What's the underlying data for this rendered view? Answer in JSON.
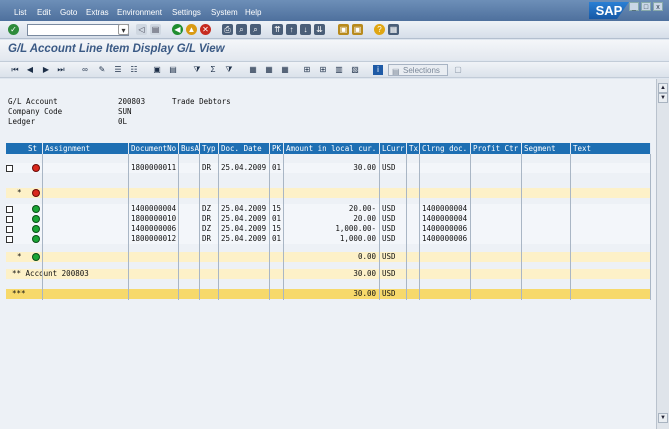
{
  "menu": {
    "items": [
      "List",
      "Edit",
      "Goto",
      "Extras",
      "Environment",
      "Settings",
      "System",
      "Help"
    ]
  },
  "logo": "SAP",
  "window_controls": [
    "_",
    "□",
    "x"
  ],
  "command_field": {
    "value": ""
  },
  "title": "G/L Account Line Item Display G/L View",
  "app_toolbar": {
    "selections_label": "Selections"
  },
  "header_fields": [
    {
      "label": "G/L Account",
      "value": "200803",
      "desc": "Trade Debtors"
    },
    {
      "label": "Company Code",
      "value": "SUN",
      "desc": ""
    },
    {
      "label": "Ledger",
      "value": "0L",
      "desc": ""
    }
  ],
  "table": {
    "columns": [
      "St",
      "Assignment",
      "DocumentNo",
      "BusA",
      "Typ",
      "Doc. Date",
      "PK",
      "Amount in local cur.",
      "LCurr",
      "Tx",
      "Clrng doc.",
      "Profit Ctr",
      "Segment",
      "Text"
    ],
    "rows": [
      {
        "kind": "item",
        "status": "red",
        "checkbox": true,
        "mark": "",
        "assignment": "",
        "docno": "1800000011",
        "busa": "",
        "typ": "DR",
        "date": "25.04.2009",
        "pk": "01",
        "amount": "30.00",
        "curr": "USD",
        "tx": "",
        "clrng": "",
        "profit": "",
        "segment": "",
        "text": ""
      },
      {
        "kind": "subtotal",
        "status": "red",
        "checkbox": false,
        "mark": "*",
        "assignment": "",
        "docno": "",
        "busa": "",
        "typ": "",
        "date": "",
        "pk": "",
        "amount": "",
        "curr": "",
        "tx": "",
        "clrng": "",
        "profit": "",
        "segment": "",
        "text": ""
      },
      {
        "kind": "item",
        "status": "green",
        "checkbox": true,
        "mark": "",
        "assignment": "",
        "docno": "1400000004",
        "busa": "",
        "typ": "DZ",
        "date": "25.04.2009",
        "pk": "15",
        "amount": "20.00-",
        "curr": "USD",
        "tx": "",
        "clrng": "1400000004",
        "profit": "",
        "segment": "",
        "text": ""
      },
      {
        "kind": "item",
        "status": "green",
        "checkbox": true,
        "mark": "",
        "assignment": "",
        "docno": "1800000010",
        "busa": "",
        "typ": "DR",
        "date": "25.04.2009",
        "pk": "01",
        "amount": "20.00",
        "curr": "USD",
        "tx": "",
        "clrng": "1400000004",
        "profit": "",
        "segment": "",
        "text": ""
      },
      {
        "kind": "item",
        "status": "green",
        "checkbox": true,
        "mark": "",
        "assignment": "",
        "docno": "1400000006",
        "busa": "",
        "typ": "DZ",
        "date": "25.04.2009",
        "pk": "15",
        "amount": "1,000.00-",
        "curr": "USD",
        "tx": "",
        "clrng": "1400000006",
        "profit": "",
        "segment": "",
        "text": ""
      },
      {
        "kind": "item",
        "status": "green",
        "checkbox": true,
        "mark": "",
        "assignment": "",
        "docno": "1800000012",
        "busa": "",
        "typ": "DR",
        "date": "25.04.2009",
        "pk": "01",
        "amount": "1,000.00",
        "curr": "USD",
        "tx": "",
        "clrng": "1400000006",
        "profit": "",
        "segment": "",
        "text": ""
      },
      {
        "kind": "subtotal",
        "status": "green",
        "checkbox": false,
        "mark": "*",
        "assignment": "",
        "docno": "",
        "busa": "",
        "typ": "",
        "date": "",
        "pk": "",
        "amount": "0.00",
        "curr": "USD",
        "tx": "",
        "clrng": "",
        "profit": "",
        "segment": "",
        "text": ""
      },
      {
        "kind": "account",
        "status": "",
        "checkbox": false,
        "mark": "** Account 200803",
        "assignment": "",
        "docno": "",
        "busa": "",
        "typ": "",
        "date": "",
        "pk": "",
        "amount": "30.00",
        "curr": "USD",
        "tx": "",
        "clrng": "",
        "profit": "",
        "segment": "",
        "text": ""
      },
      {
        "kind": "grand",
        "status": "",
        "checkbox": false,
        "mark": "***",
        "assignment": "",
        "docno": "",
        "busa": "",
        "typ": "",
        "date": "",
        "pk": "",
        "amount": "30.00",
        "curr": "USD",
        "tx": "",
        "clrng": "",
        "profit": "",
        "segment": "",
        "text": ""
      }
    ]
  },
  "colors": {
    "header_blue": "#1e6fb3",
    "subtotal_yellow": "#fdf1c8",
    "grand_yellow": "#f7d96b",
    "item_bg": "#f3f6fa"
  }
}
